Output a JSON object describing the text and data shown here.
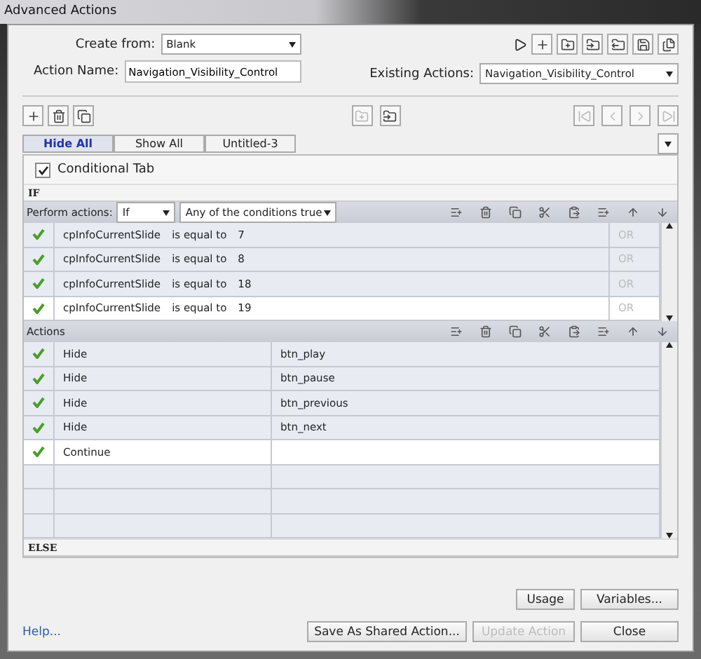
{
  "window": {
    "title": "Advanced Actions"
  },
  "create_from": {
    "label": "Create from:",
    "value": "Blank"
  },
  "action_name": {
    "label": "Action Name:",
    "value": "Navigation_Visibility_Control"
  },
  "existing_actions": {
    "label": "Existing Actions:",
    "value": "Navigation_Visibility_Control"
  },
  "tabs": [
    {
      "label": "Hide All",
      "selected": true
    },
    {
      "label": "Show All",
      "selected": false
    },
    {
      "label": "Untitled-3",
      "selected": false
    }
  ],
  "conditional_tab": {
    "label": "Conditional Tab",
    "checked": true
  },
  "if_label": "IF",
  "perform": {
    "label": "Perform actions:",
    "mode": "If",
    "condition": "Any of the conditions true"
  },
  "conditions": [
    {
      "checked": true,
      "variable": "cpInfoCurrentSlide",
      "operator": "is equal to",
      "value": "7",
      "joiner": "OR",
      "selected": false
    },
    {
      "checked": true,
      "variable": "cpInfoCurrentSlide",
      "operator": "is equal to",
      "value": "8",
      "joiner": "OR",
      "selected": false
    },
    {
      "checked": true,
      "variable": "cpInfoCurrentSlide",
      "operator": "is equal to",
      "value": "18",
      "joiner": "OR",
      "selected": false
    },
    {
      "checked": true,
      "variable": "cpInfoCurrentSlide",
      "operator": "is equal to",
      "value": "19",
      "joiner": "OR",
      "selected": true
    }
  ],
  "actions_label": "Actions",
  "actions": [
    {
      "checked": true,
      "action": "Hide",
      "target": "btn_play",
      "selected": false
    },
    {
      "checked": true,
      "action": "Hide",
      "target": "btn_pause",
      "selected": false
    },
    {
      "checked": true,
      "action": "Hide",
      "target": "btn_previous",
      "selected": false
    },
    {
      "checked": true,
      "action": "Hide",
      "target": "btn_next",
      "selected": false
    },
    {
      "checked": true,
      "action": "Continue",
      "selected": true
    }
  ],
  "else_label": "ELSE",
  "side_buttons": [
    {
      "label": "Usage",
      "disabled": false
    },
    {
      "label": "Variables...",
      "disabled": false
    }
  ],
  "help": "Help...",
  "bottom_buttons": [
    {
      "label": "Save As Shared Action...",
      "disabled": false
    },
    {
      "label": "Update Action",
      "disabled": true
    },
    {
      "label": "Close",
      "disabled": false
    }
  ]
}
